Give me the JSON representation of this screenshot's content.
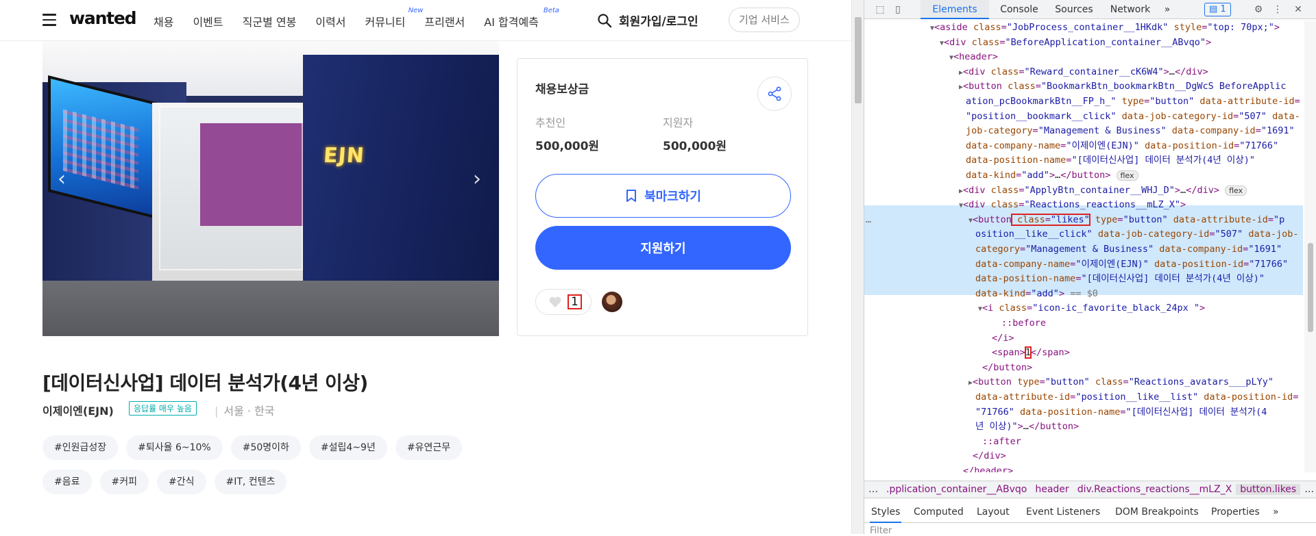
{
  "nav": {
    "logo": "wanted",
    "menu": [
      {
        "label": "채용",
        "sup": ""
      },
      {
        "label": "이벤트",
        "sup": ""
      },
      {
        "label": "직군별 연봉",
        "sup": ""
      },
      {
        "label": "이력서",
        "sup": ""
      },
      {
        "label": "커뮤니티",
        "sup": "New"
      },
      {
        "label": "프리랜서",
        "sup": ""
      },
      {
        "label": "AI 합격예측",
        "sup": "Beta"
      }
    ],
    "login": "회원가입/로그인",
    "corporate": "기업 서비스"
  },
  "hero": {
    "sign_text": "EJN"
  },
  "reward": {
    "title": "채용보상금",
    "recommender_label": "추천인",
    "recommender_amount": "500,000원",
    "applicant_label": "지원자",
    "applicant_amount": "500,000원",
    "bookmark_label": "북마크하기",
    "apply_label": "지원하기",
    "likes_count": "1"
  },
  "job": {
    "title": "[데이터신사업] 데이터 분석가(4년 이상)",
    "company": "이제이엔(EJN)",
    "badge": "응답률 매우 높음",
    "location": "서울 · 한국",
    "tags_row1": [
      "#인원급성장",
      "#퇴사율 6~10%",
      "#50명이하",
      "#설립4~9년",
      "#유연근무"
    ],
    "tags_row2": [
      "#음료",
      "#커피",
      "#간식",
      "#IT, 컨텐츠"
    ]
  },
  "devtools": {
    "tabs": [
      "Elements",
      "Console",
      "Sources",
      "Network"
    ],
    "more": "»",
    "issues_count": "1",
    "crumbs": [
      ".pplication_container__ABvqo",
      "header",
      "div.Reactions_reactions__mLZ_X",
      "button.likes"
    ],
    "crumbs_more": "…",
    "crumbs_lead": "…",
    "subtabs": [
      "Styles",
      "Computed",
      "Layout",
      "Event Listeners",
      "DOM Breakpoints",
      "Properties"
    ],
    "subtabs_more": "»",
    "filter_placeholder": "Filter"
  }
}
